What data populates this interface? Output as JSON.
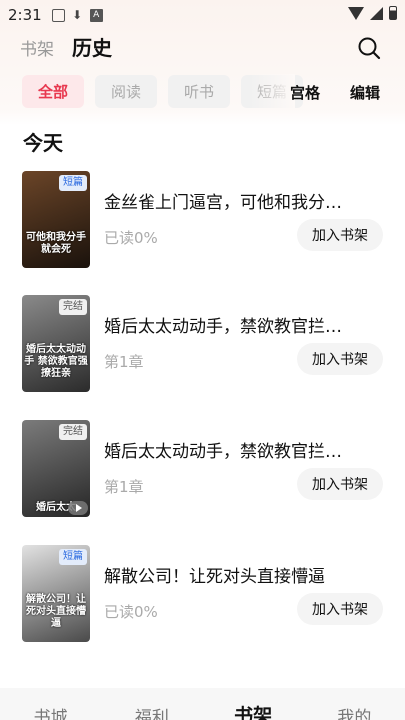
{
  "status_bar": {
    "time": "2:31",
    "icons": [
      "image-icon",
      "download-icon",
      "font-icon"
    ],
    "right_icons": [
      "wifi-icon",
      "signal-icon",
      "battery-icon"
    ]
  },
  "header": {
    "tabs": [
      {
        "label": "书架",
        "active": false
      },
      {
        "label": "历史",
        "active": true
      }
    ],
    "search_icon": "search-icon"
  },
  "filters": {
    "chips": [
      {
        "label": "全部",
        "active": true
      },
      {
        "label": "阅读",
        "active": false
      },
      {
        "label": "听书",
        "active": false
      },
      {
        "label": "短篇",
        "active": false
      }
    ],
    "view_toggle": "宫格",
    "edit": "编辑"
  },
  "section": {
    "title": "今天"
  },
  "books": [
    {
      "title": "金丝雀上门逼宫，可他和我分…",
      "progress": "已读0%",
      "badge": "短篇",
      "cover_text": "可他和我分手就会死",
      "cover_colors": [
        "#5a3a22",
        "#1a120c"
      ],
      "action": "加入书架"
    },
    {
      "title": "婚后太太动动手，禁欲教官拦…",
      "progress": "第1章",
      "badge": "完结",
      "cover_text": "婚后太太动动手 禁欲教官强撩狂亲",
      "cover_colors": [
        "#7a7a7a",
        "#2b2b2b"
      ],
      "action": "加入书架"
    },
    {
      "title": "婚后太太动动手，禁欲教官拦…",
      "progress": "第1章",
      "badge": "完结",
      "cover_text": "婚后太太",
      "cover_colors": [
        "#6b6b6b",
        "#262626"
      ],
      "action": "加入书架",
      "video": true
    },
    {
      "title": "解散公司！让死对头直接懵逼",
      "progress": "已读0%",
      "badge": "短篇",
      "cover_text": "解散公司！让死对头直接懵逼",
      "cover_colors": [
        "#d8d8d8",
        "#4a4a4a"
      ],
      "action": "加入书架"
    }
  ],
  "bottom_nav": [
    {
      "label": "书城",
      "active": false
    },
    {
      "label": "福利",
      "active": false
    },
    {
      "label": "书架",
      "active": true
    },
    {
      "label": "我的",
      "active": false
    }
  ],
  "colors": {
    "accent": "#e8384f",
    "chip_active_bg": "#fde8ea",
    "badge_short": "#2d6be0"
  }
}
